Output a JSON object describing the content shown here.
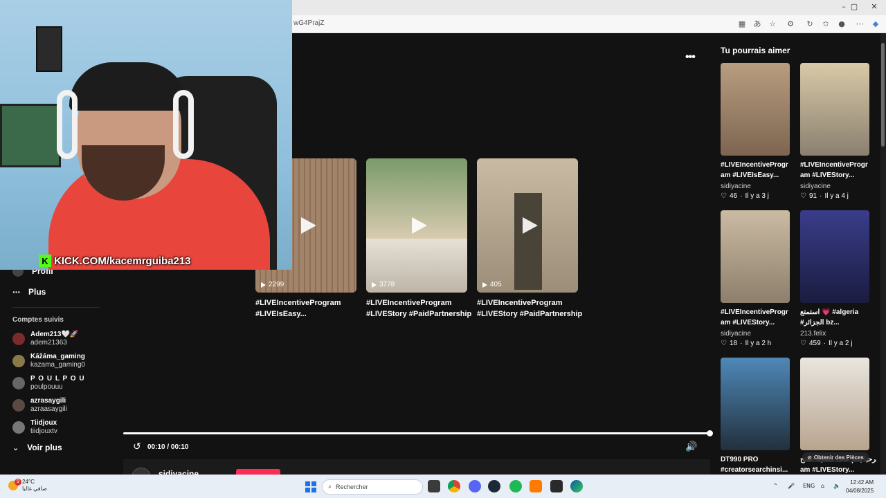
{
  "browser": {
    "url_fragment": "wG4PrajZ",
    "window_controls": [
      "–",
      "▢",
      "✕"
    ]
  },
  "overlay": {
    "kick_letter": "K",
    "kick_url": "KICK.COM/kacemrguiba213"
  },
  "sidebar": {
    "nav": [
      {
        "label": "Profil"
      },
      {
        "label": "Plus"
      }
    ],
    "followed_title": "Comptes suivis",
    "followed": [
      {
        "name": "Adem213🤍🚀",
        "handle": "adem21363"
      },
      {
        "name": "Kāžāma_gaming",
        "handle": "kazama_gaming0"
      },
      {
        "name": "P O U L P O U",
        "handle": "poulpouuu"
      },
      {
        "name": "azrasaygili",
        "handle": "azraasaygili"
      },
      {
        "name": "Tiidjoux",
        "handle": "tiidjouxtv"
      }
    ],
    "see_more": "Voir plus"
  },
  "player": {
    "videos": [
      {
        "count": "2299",
        "caption1": "#LIVEIncentiveProgram",
        "caption2": "#LIVEIsEasy..."
      },
      {
        "count": "3778",
        "caption1": "#LIVEIncentiveProgram",
        "caption2": "#LIVEStory #PaidPartnership"
      },
      {
        "count": "405",
        "caption1": "#LIVEIncentiveProgram",
        "caption2": "#LIVEStory #PaidPartnership"
      }
    ],
    "time": "00:10 / 00:10",
    "progress": 1.0,
    "author": "sidiyacine"
  },
  "suggestions": {
    "title": "Tu pourrais aimer",
    "items": [
      {
        "cap1": "#LIVEIncentiveProgr",
        "cap2": "am #LIVEIsEasy...",
        "author": "sidiyacine",
        "likes": "46",
        "age": "Il y a 3 j",
        "colors": [
          "#b89d80",
          "#7d6550"
        ]
      },
      {
        "cap1": "#LIVEIncentiveProgr",
        "cap2": "am #LIVEStory...",
        "author": "sidiyacine",
        "likes": "91",
        "age": "Il y a 4 j",
        "colors": [
          "#d9c9a8",
          "#8a8070"
        ]
      },
      {
        "cap1": "#LIVEIncentiveProgr",
        "cap2": "am #LIVEStory...",
        "author": "sidiyacine",
        "likes": "18",
        "age": "Il y a 2 h",
        "colors": [
          "#cbbba3",
          "#8d7f6c"
        ]
      },
      {
        "cap1": "استمتع 💗 #algeria",
        "cap2": "#الجزائر bz...",
        "author": "213.felix",
        "likes": "459",
        "age": "Il y a 2 j",
        "colors": [
          "#3a3d8a",
          "#1a1c40"
        ]
      },
      {
        "cap1": "DT990 PRO",
        "cap2": "#creatorsearchinsi...",
        "author": "",
        "likes": "",
        "age": "",
        "colors": [
          "#4f88b8",
          "#22303d"
        ]
      },
      {
        "cap1": "مرحبا بكم خاف مسجد الفتح",
        "cap2": "am #LIVEStory...",
        "author": "",
        "likes": "",
        "age": "",
        "colors": [
          "#e9e6e0",
          "#b8a48e"
        ]
      }
    ],
    "obtain_label": "Obtenir des Pièces"
  },
  "taskbar": {
    "weather_badge": "9",
    "temperature": "24°C",
    "weather_text": "صافي غالبا",
    "search_placeholder": "Rechercher",
    "lang": "ENG",
    "time": "12:42 AM",
    "date": "04/08/2025"
  },
  "colors": {
    "accent": "#fe2c55",
    "kick_green": "#53fc18",
    "page_bg": "#121212"
  }
}
